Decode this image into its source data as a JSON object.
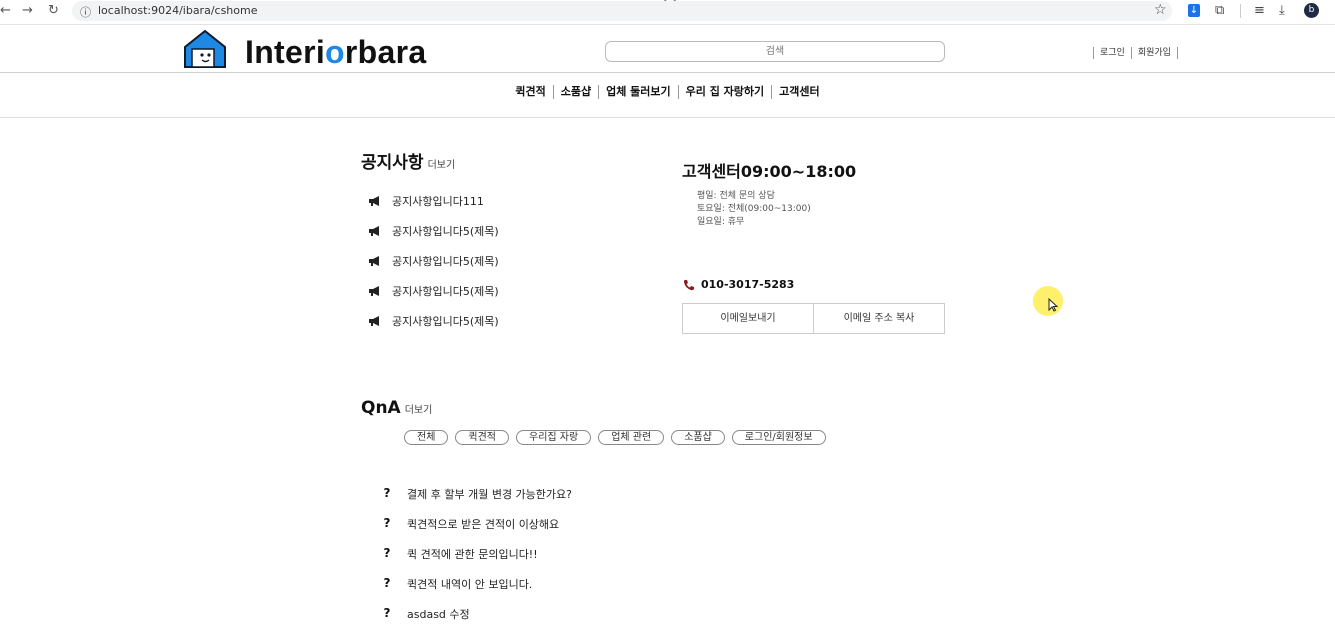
{
  "browser": {
    "url": "localhost:9024/ibara/cshome",
    "profile_initial": "b"
  },
  "header": {
    "logo_text_before": "Interi",
    "logo_text_mark": "o",
    "logo_text_after": "rbara",
    "search_placeholder": "검색",
    "login": "로그인",
    "signup": "회원가입"
  },
  "menu": [
    "퀵견적",
    "소품샵",
    "업체 둘러보기",
    "우리 집 자랑하기",
    "고객센터"
  ],
  "notice": {
    "title": "공지사항",
    "more": "더보기",
    "items": [
      "공지사항입니다111",
      "공지사항입니다5(제목)",
      "공지사항입니다5(제목)",
      "공지사항입니다5(제목)",
      "공지사항입니다5(제목)"
    ]
  },
  "cs": {
    "title": "고객센터09:00~18:00",
    "hours": [
      "평일: 전체 문의 상담",
      "토요일: 전체(09:00~13:00)",
      "일요일: 휴무"
    ],
    "phone": "010-3017-5283",
    "email_btn": "이메일보내기",
    "copy_btn": "이메일 주소 복사"
  },
  "qna": {
    "title": "QnA",
    "more": "더보기",
    "tags": [
      "전체",
      "퀵견적",
      "우리집 자랑",
      "업체 관련",
      "소품샵",
      "로그인/회원정보"
    ],
    "items": [
      "결제 후 할부 개월 변경 가능한가요?",
      "퀵견적으로 받은 견적이 이상해요",
      "퀵 견적에 관한 문의입니다!!",
      "퀵견적 내역이 안 보입니다.",
      "asdasd 수정"
    ]
  },
  "colors": {
    "brand_blue": "#1e88e5",
    "phone_red": "#8b1a1a",
    "highlight": "#ffeb3b"
  }
}
